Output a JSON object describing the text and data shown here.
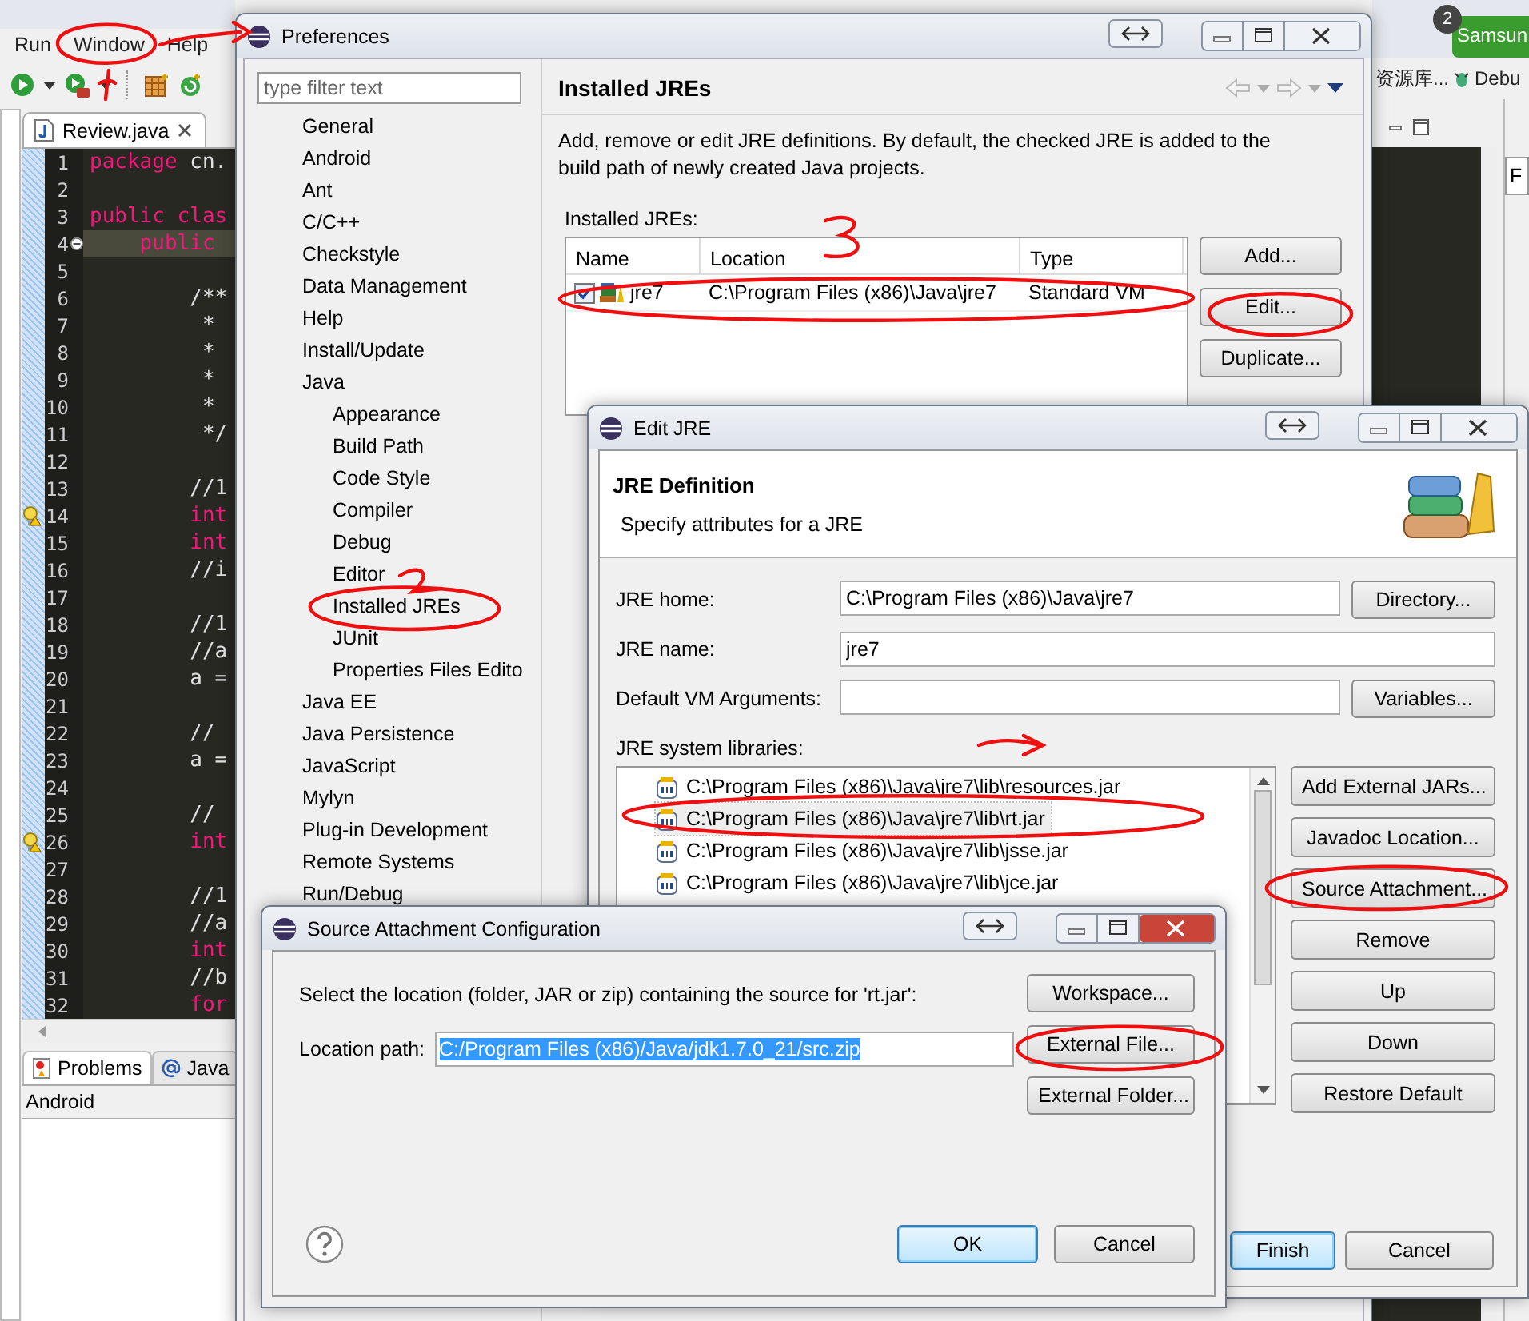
{
  "ide": {
    "menu": [
      "Run",
      "Window",
      "Help"
    ],
    "editor_tab": "Review.java",
    "code_lines": [
      {
        "number": "1",
        "current": false,
        "warning": false,
        "parts": [
          {
            "text": "package",
            "kind": "keyword"
          },
          {
            "text": " cn.",
            "kind": "plain"
          }
        ]
      },
      {
        "number": "2",
        "current": false,
        "warning": false
      },
      {
        "number": "3",
        "current": false,
        "warning": false,
        "parts": [
          {
            "text": "public clas",
            "kind": "keyword"
          }
        ]
      },
      {
        "number": "4",
        "current": true,
        "warning": false,
        "parts": [
          {
            "text": "    public",
            "kind": "keyword"
          }
        ]
      },
      {
        "number": "5",
        "current": false,
        "warning": false
      },
      {
        "number": "6",
        "current": false,
        "warning": false,
        "parts": [
          {
            "text": "        /**",
            "kind": "plain"
          }
        ]
      },
      {
        "number": "7",
        "current": false,
        "warning": false,
        "parts": [
          {
            "text": "         *",
            "kind": "plain"
          }
        ]
      },
      {
        "number": "8",
        "current": false,
        "warning": false,
        "parts": [
          {
            "text": "         *",
            "kind": "plain"
          }
        ]
      },
      {
        "number": "9",
        "current": false,
        "warning": false,
        "parts": [
          {
            "text": "         *",
            "kind": "plain"
          }
        ]
      },
      {
        "number": "10",
        "current": false,
        "warning": false,
        "parts": [
          {
            "text": "         *",
            "kind": "plain"
          }
        ]
      },
      {
        "number": "11",
        "current": false,
        "warning": false,
        "parts": [
          {
            "text": "         */",
            "kind": "plain"
          }
        ]
      },
      {
        "number": "12",
        "current": false,
        "warning": false
      },
      {
        "number": "13",
        "current": false,
        "warning": false,
        "parts": [
          {
            "text": "        //1",
            "kind": "plain"
          }
        ]
      },
      {
        "number": "14",
        "current": false,
        "warning": true,
        "parts": [
          {
            "text": "        int",
            "kind": "keyword"
          }
        ]
      },
      {
        "number": "15",
        "current": false,
        "warning": false,
        "parts": [
          {
            "text": "        int",
            "kind": "keyword"
          }
        ]
      },
      {
        "number": "16",
        "current": false,
        "warning": false,
        "parts": [
          {
            "text": "        //i",
            "kind": "plain"
          }
        ]
      },
      {
        "number": "17",
        "current": false,
        "warning": false
      },
      {
        "number": "18",
        "current": false,
        "warning": false,
        "parts": [
          {
            "text": "        //1",
            "kind": "plain"
          }
        ]
      },
      {
        "number": "19",
        "current": false,
        "warning": false,
        "parts": [
          {
            "text": "        //a",
            "kind": "plain"
          }
        ]
      },
      {
        "number": "20",
        "current": false,
        "warning": false,
        "parts": [
          {
            "text": "        a =",
            "kind": "plain"
          }
        ]
      },
      {
        "number": "21",
        "current": false,
        "warning": false
      },
      {
        "number": "22",
        "current": false,
        "warning": false,
        "parts": [
          {
            "text": "        //",
            "kind": "plain"
          }
        ]
      },
      {
        "number": "23",
        "current": false,
        "warning": false,
        "parts": [
          {
            "text": "        a =",
            "kind": "plain"
          }
        ]
      },
      {
        "number": "24",
        "current": false,
        "warning": false
      },
      {
        "number": "25",
        "current": false,
        "warning": false,
        "parts": [
          {
            "text": "        //",
            "kind": "plain"
          }
        ]
      },
      {
        "number": "26",
        "current": false,
        "warning": true,
        "parts": [
          {
            "text": "        int",
            "kind": "keyword"
          }
        ]
      },
      {
        "number": "27",
        "current": false,
        "warning": false
      },
      {
        "number": "28",
        "current": false,
        "warning": false,
        "parts": [
          {
            "text": "        //1",
            "kind": "plain"
          }
        ]
      },
      {
        "number": "29",
        "current": false,
        "warning": false,
        "parts": [
          {
            "text": "        //a",
            "kind": "plain"
          }
        ]
      },
      {
        "number": "30",
        "current": false,
        "warning": false,
        "parts": [
          {
            "text": "        int",
            "kind": "keyword"
          }
        ]
      },
      {
        "number": "31",
        "current": false,
        "warning": false,
        "parts": [
          {
            "text": "        //b",
            "kind": "plain"
          }
        ]
      },
      {
        "number": "32",
        "current": false,
        "warning": false,
        "parts": [
          {
            "text": "        for",
            "kind": "keyword"
          }
        ]
      }
    ],
    "bottom_tabs": [
      {
        "label": "Problems",
        "selected": true
      },
      {
        "label": "Java",
        "selected": false
      }
    ],
    "bottom_view_title": "Android",
    "notification": {
      "count": "2",
      "label": "Samsun"
    },
    "toolbar_labels": [
      "资源库...",
      "Debu"
    ],
    "side_field": "F"
  },
  "preferences": {
    "title": "Preferences",
    "active": false,
    "filter_placeholder": "type filter text",
    "tree": [
      {
        "label": "General"
      },
      {
        "label": "Android"
      },
      {
        "label": "Ant"
      },
      {
        "label": "C/C++"
      },
      {
        "label": "Checkstyle"
      },
      {
        "label": "Data Management"
      },
      {
        "label": "Help"
      },
      {
        "label": "Install/Update"
      },
      {
        "label": "Java",
        "children": [
          {
            "label": "Appearance"
          },
          {
            "label": "Build Path"
          },
          {
            "label": "Code Style"
          },
          {
            "label": "Compiler"
          },
          {
            "label": "Debug"
          },
          {
            "label": "Editor"
          },
          {
            "label": "Installed JREs"
          },
          {
            "label": "JUnit"
          },
          {
            "label": "Properties Files Edito"
          }
        ]
      },
      {
        "label": "Java EE"
      },
      {
        "label": "Java Persistence"
      },
      {
        "label": "JavaScript"
      },
      {
        "label": "Mylyn"
      },
      {
        "label": "Plug-in Development"
      },
      {
        "label": "Remote Systems"
      },
      {
        "label": "Run/Debug"
      }
    ],
    "page_title": "Installed JREs",
    "description": "Add, remove or edit JRE definitions. By default, the checked JRE is added to the build path of newly created Java projects.",
    "table_label": "Installed JREs:",
    "columns": [
      "Name",
      "Location",
      "Type"
    ],
    "rows": [
      {
        "checked": true,
        "name": "jre7",
        "location": "C:\\Program Files (x86)\\Java\\jre7",
        "type": "Standard VM"
      }
    ],
    "buttons": [
      "Add...",
      "Edit...",
      "Duplicate..."
    ]
  },
  "edit_jre": {
    "title": "Edit JRE",
    "active": false,
    "header": "JRE Definition",
    "subtitle": "Specify attributes for a JRE",
    "fields": [
      {
        "label": "JRE home:",
        "value": "C:\\Program Files (x86)\\Java\\jre7",
        "button": "Directory..."
      },
      {
        "label": "JRE name:",
        "value": "jre7"
      },
      {
        "label": "Default VM Arguments:",
        "button": "Variables..."
      }
    ],
    "libraries_label": "JRE system libraries:",
    "libraries": [
      {
        "path": "C:\\Program Files (x86)\\Java\\jre7\\lib\\resources.jar",
        "selected": false
      },
      {
        "path": "C:\\Program Files (x86)\\Java\\jre7\\lib\\rt.jar",
        "selected": true
      },
      {
        "path": "C:\\Program Files (x86)\\Java\\jre7\\lib\\jsse.jar",
        "selected": false
      },
      {
        "path": "C:\\Program Files (x86)\\Java\\jre7\\lib\\jce.jar",
        "selected": false
      }
    ],
    "library_buttons": [
      "Add External JARs...",
      "Javadoc Location...",
      "Source Attachment...",
      "Remove",
      "Up",
      "Down",
      "Restore Default"
    ],
    "footer_buttons": [
      {
        "label": "Finish",
        "default": true
      },
      {
        "label": "Cancel",
        "default": false
      }
    ]
  },
  "source_attachment": {
    "title": "Source Attachment Configuration",
    "active": true,
    "prompt": "Select the location (folder, JAR or zip) containing the source for 'rt.jar':",
    "location_label": "Location path:",
    "location_value": "C:/Program Files (x86)/Java/jdk1.7.0_21/src.zip",
    "value_selected": true,
    "side_buttons": [
      "Workspace...",
      "External File...",
      "External Folder..."
    ],
    "footer_buttons": [
      {
        "label": "OK",
        "default": true
      },
      {
        "label": "Cancel",
        "default": false
      }
    ]
  }
}
